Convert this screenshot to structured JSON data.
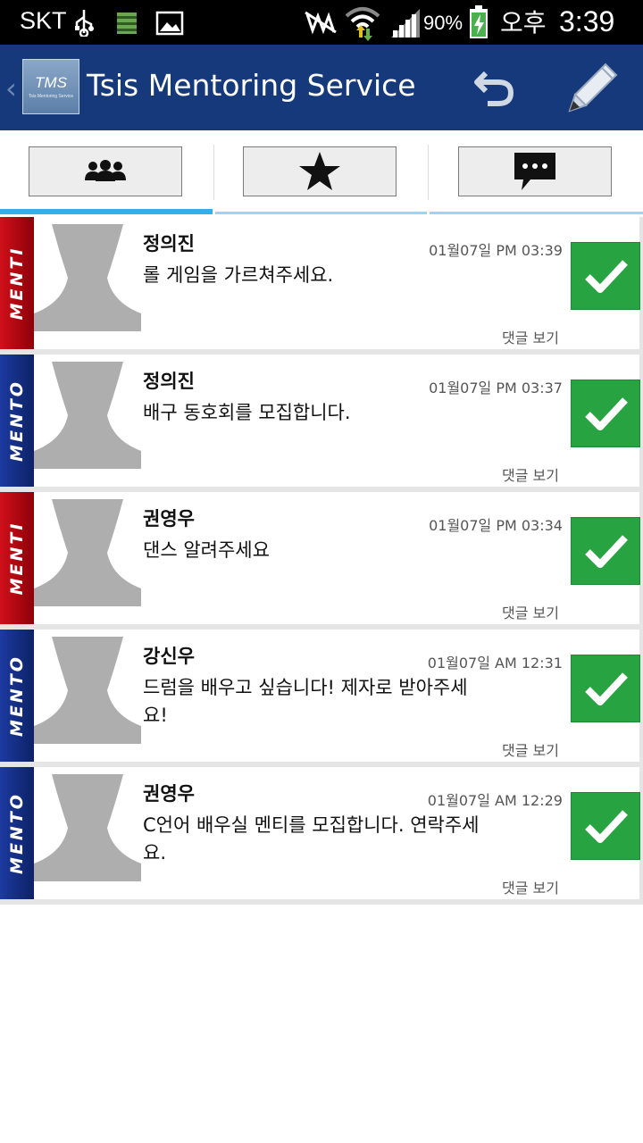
{
  "status_bar": {
    "carrier": "SKT",
    "battery": "90%",
    "ampm": "오후",
    "time": "3:39",
    "icons": [
      "usb-icon",
      "sdcard-icon",
      "image-icon",
      "mute-icon",
      "wifi-icon",
      "signal-icon",
      "battery-icon"
    ]
  },
  "app_bar": {
    "logo_text": "TMS",
    "logo_subtext": "Tsis Mentoring Service",
    "title": "Tsis Mentoring Service",
    "actions": [
      "undo-icon",
      "pencil-icon"
    ]
  },
  "tabs": [
    {
      "icon": "people-icon",
      "active": true
    },
    {
      "icon": "star-icon",
      "active": false
    },
    {
      "icon": "chat-icon",
      "active": false
    }
  ],
  "colors": {
    "app_bar": "#15397a",
    "tab_indicator": "#36aee6",
    "menti_ribbon": "#c0101a",
    "mento_ribbon": "#1c3aa0",
    "check_button": "#27a341"
  },
  "comment_label": "댓글 보기",
  "posts": [
    {
      "role": "MENTI",
      "name": "정의진",
      "date": "01월07일 PM 03:39",
      "message": "롤 게임을 가르쳐주세요."
    },
    {
      "role": "MENTO",
      "name": "정의진",
      "date": "01월07일 PM 03:37",
      "message": "배구 동호회를 모집합니다."
    },
    {
      "role": "MENTI",
      "name": "권영우",
      "date": "01월07일 PM 03:34",
      "message": "댄스 알려주세요"
    },
    {
      "role": "MENTO",
      "name": "강신우",
      "date": "01월07일 AM 12:31",
      "message": "드럼을 배우고 싶습니다! 제자로 받아주세요!"
    },
    {
      "role": "MENTO",
      "name": "권영우",
      "date": "01월07일 AM 12:29",
      "message": "C언어 배우실 멘티를 모집합니다. 연락주세요."
    }
  ]
}
